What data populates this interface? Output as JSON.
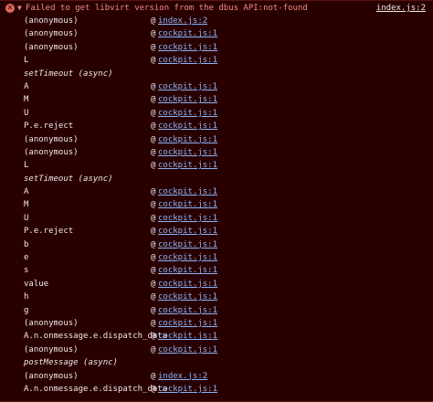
{
  "error": {
    "icon": "error-x-icon",
    "icon_glyph": "✕",
    "toggle_glyph": "▼",
    "message": "Failed to get libvirt version from the dbus API:not-found",
    "source": "index.js:2",
    "colors": {
      "background": "#290000",
      "message": "#f28b82",
      "link": "#8ab4f8",
      "text": "#f0e8e8"
    }
  },
  "stack": [
    {
      "fn": "(anonymous)",
      "at": "@",
      "src": "index.js:2"
    },
    {
      "fn": "(anonymous)",
      "at": "@",
      "src": "cockpit.js:1"
    },
    {
      "fn": "(anonymous)",
      "at": "@",
      "src": "cockpit.js:1"
    },
    {
      "fn": "L",
      "at": "@",
      "src": "cockpit.js:1"
    },
    {
      "fn": "setTimeout (async)",
      "async": true
    },
    {
      "fn": "A",
      "at": "@",
      "src": "cockpit.js:1"
    },
    {
      "fn": "M",
      "at": "@",
      "src": "cockpit.js:1"
    },
    {
      "fn": "U",
      "at": "@",
      "src": "cockpit.js:1"
    },
    {
      "fn": "P.e.reject",
      "at": "@",
      "src": "cockpit.js:1"
    },
    {
      "fn": "(anonymous)",
      "at": "@",
      "src": "cockpit.js:1"
    },
    {
      "fn": "(anonymous)",
      "at": "@",
      "src": "cockpit.js:1"
    },
    {
      "fn": "L",
      "at": "@",
      "src": "cockpit.js:1"
    },
    {
      "fn": "setTimeout (async)",
      "async": true
    },
    {
      "fn": "A",
      "at": "@",
      "src": "cockpit.js:1"
    },
    {
      "fn": "M",
      "at": "@",
      "src": "cockpit.js:1"
    },
    {
      "fn": "U",
      "at": "@",
      "src": "cockpit.js:1"
    },
    {
      "fn": "P.e.reject",
      "at": "@",
      "src": "cockpit.js:1"
    },
    {
      "fn": "b",
      "at": "@",
      "src": "cockpit.js:1"
    },
    {
      "fn": "e",
      "at": "@",
      "src": "cockpit.js:1"
    },
    {
      "fn": "s",
      "at": "@",
      "src": "cockpit.js:1"
    },
    {
      "fn": "value",
      "at": "@",
      "src": "cockpit.js:1"
    },
    {
      "fn": "h",
      "at": "@",
      "src": "cockpit.js:1"
    },
    {
      "fn": "g",
      "at": "@",
      "src": "cockpit.js:1"
    },
    {
      "fn": "(anonymous)",
      "at": "@",
      "src": "cockpit.js:1"
    },
    {
      "fn": "A.n.onmessage.e.dispatch_data",
      "at": "@",
      "src": "cockpit.js:1"
    },
    {
      "fn": "(anonymous)",
      "at": "@",
      "src": "cockpit.js:1"
    },
    {
      "fn": "postMessage (async)",
      "async": true
    },
    {
      "fn": "(anonymous)",
      "at": "@",
      "src": "index.js:2"
    },
    {
      "fn": "A.n.onmessage.e.dispatch_data",
      "at": "@",
      "src": "cockpit.js:1"
    }
  ]
}
